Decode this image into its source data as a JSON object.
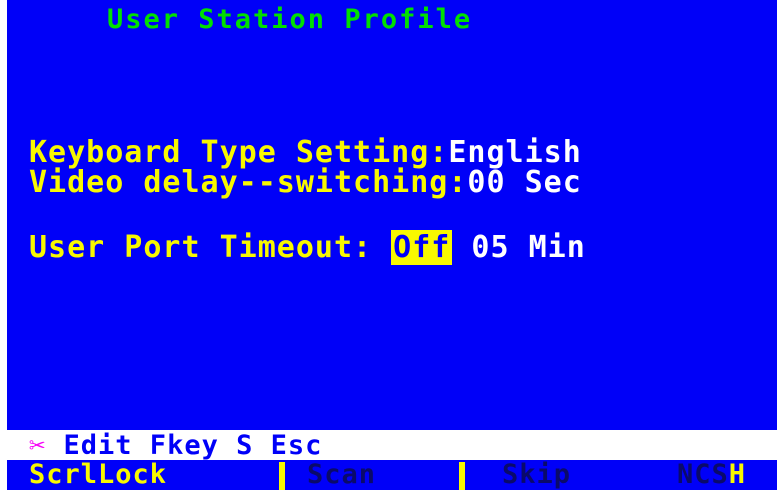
{
  "title": "User Station Profile",
  "fields": {
    "keyboard_label": "Keyboard Type Setting:",
    "keyboard_value": "English",
    "video_label": "Video delay--switching:",
    "video_value": "00 Sec",
    "timeout_label": "User Port Timeout:",
    "timeout_selected": "Off",
    "timeout_value": "05 Min"
  },
  "help_bar": {
    "emblem": "✂",
    "text": "Edit Fkey S Esc"
  },
  "status_bar": {
    "scroll_lock": "ScrlLock",
    "scan": "Scan",
    "skip": "Skip",
    "ncs": "NCS",
    "ncs_suffix": "H"
  },
  "colors": {
    "background": "#0000f8",
    "title": "#00e000",
    "label": "#f8f800",
    "value": "#ffffff",
    "emblem": "#f800f8"
  }
}
